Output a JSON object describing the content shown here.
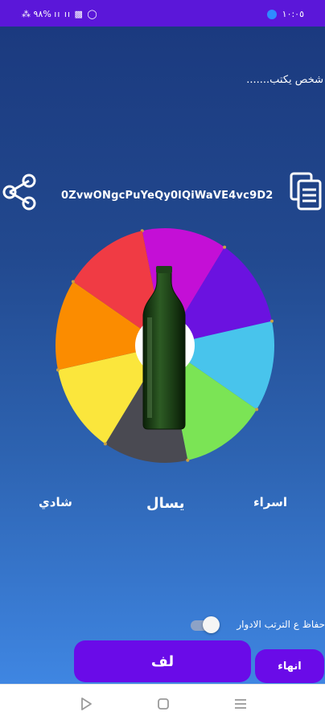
{
  "status_bar": {
    "left_text": "⁂ ٩٨% ıı ıı ▩ ◯",
    "time": "١٠:٠٥",
    "bluetooth_icon": "bluetooth-icon"
  },
  "game": {
    "typing_text": "شخص يكتب.......",
    "room_code": "0ZvwONgcPuYeQy0lQiWaVE4vc9D2",
    "wheel_segment_colors": [
      "#c40fd6",
      "#6b12e0",
      "#48c4ec",
      "#7be455",
      "#4a4a52",
      "#fbe63c",
      "#fb8c00",
      "#f03b44"
    ],
    "players": {
      "left": "شادي",
      "center": "يسال",
      "right": "اسراء"
    },
    "keep_order_label": "حفاظ ع الترتب الادوار",
    "keep_order_enabled": false,
    "spin_button": "لف",
    "end_button": "انهاء"
  },
  "icons": {
    "share": "share-icon",
    "copy": "copy-icon",
    "bottle": "bottle-icon"
  },
  "navigation": {
    "back": "back-icon",
    "home": "home-icon",
    "recents": "recents-icon"
  }
}
